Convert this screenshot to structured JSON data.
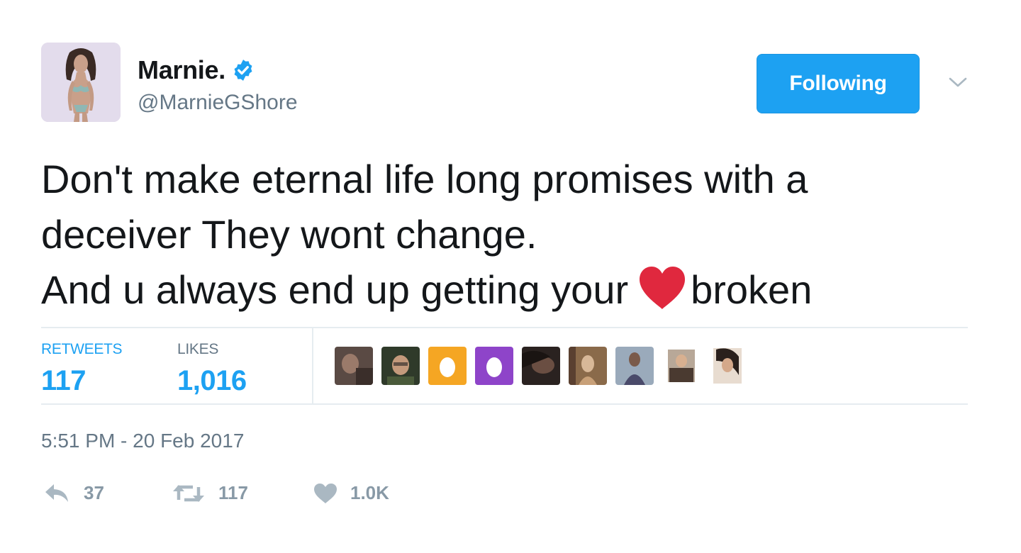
{
  "user": {
    "name": "Marnie.",
    "handle": "@MarnieGShore",
    "verified": true
  },
  "follow_button": {
    "label": "Following"
  },
  "tweet": {
    "lines": [
      "Don't make eternal life long promises with a",
      "deceiver They wont change.",
      "And u always end up getting your"
    ],
    "line3_suffix": "broken",
    "emoji": "red-heart"
  },
  "stats": {
    "retweets_label": "RETWEETS",
    "retweets_value": "117",
    "likes_label": "LIKES",
    "likes_value": "1,016"
  },
  "likers_count_shown": 9,
  "timestamp": "5:51 PM - 20 Feb 2017",
  "actions": {
    "reply_count": "37",
    "retweet_count": "117",
    "like_count": "1.0K"
  },
  "colors": {
    "accent": "#1da1f2",
    "muted": "#657786",
    "icon": "#aab8c2",
    "heart_emoji": "#e0283e",
    "egg_orange": "#f5a623",
    "egg_purple": "#8e44c9"
  }
}
